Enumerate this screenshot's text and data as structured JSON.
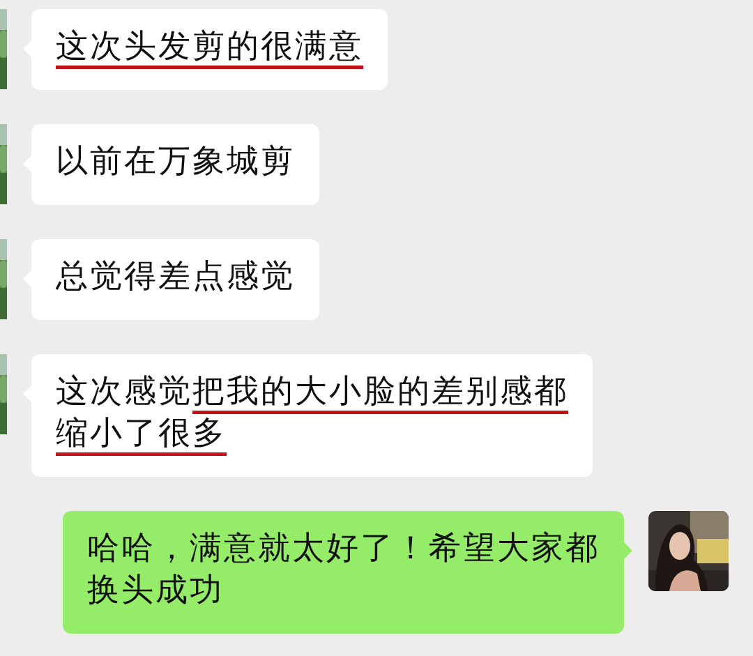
{
  "messages": [
    {
      "kind": "received",
      "lines": [
        [
          {
            "text": "这次头发剪的很满意",
            "underlined": true
          }
        ]
      ]
    },
    {
      "kind": "received",
      "lines": [
        [
          {
            "text": "以前在万象城剪",
            "underlined": false
          }
        ]
      ]
    },
    {
      "kind": "received",
      "lines": [
        [
          {
            "text": "总觉得差点感觉",
            "underlined": false
          }
        ]
      ]
    },
    {
      "kind": "received",
      "lines": [
        [
          {
            "text": "这次感觉",
            "underlined": false
          },
          {
            "text": "把我的大小脸的差别感都",
            "underlined": true
          }
        ],
        [
          {
            "text": "缩小了很多",
            "underlined": true
          }
        ]
      ]
    },
    {
      "kind": "sent",
      "lines": [
        [
          {
            "text": "哈哈，满意就太好了！希望大家都",
            "underlined": false
          }
        ],
        [
          {
            "text": "换头成功",
            "underlined": false
          }
        ]
      ]
    }
  ]
}
